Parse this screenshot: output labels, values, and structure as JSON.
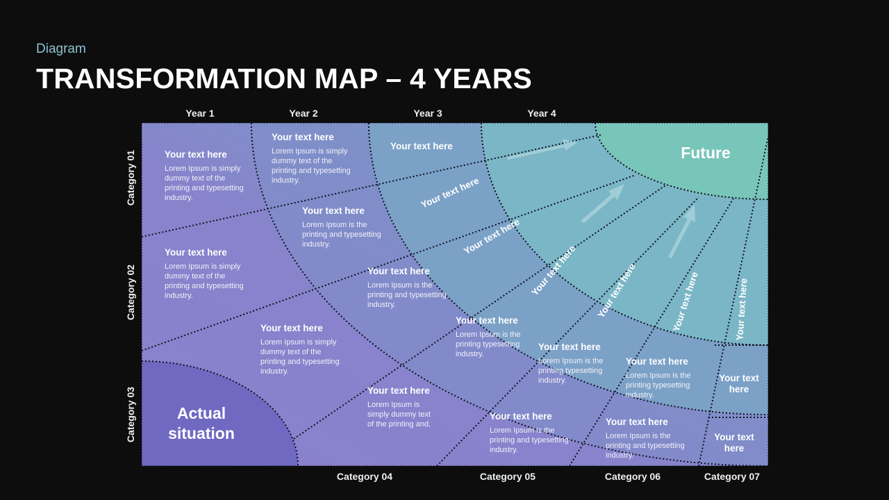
{
  "header": {
    "subtitle": "Diagram",
    "title": "TRANSFORMATION MAP – 4 YEARS"
  },
  "years": [
    "Year 1",
    "Year 2",
    "Year 3",
    "Year 4"
  ],
  "categories_left": [
    "Category 01",
    "Category 02",
    "Category 03"
  ],
  "categories_bottom": [
    "Category 04",
    "Category 05",
    "Category 06",
    "Category 07"
  ],
  "colors": {
    "background": "#0d0d0d",
    "purple": "#8a80cc",
    "purple_dark": "#7069c1",
    "blue_mid": "#7e92c8",
    "teal_light": "#7ab6c6",
    "teal_future": "#78c5b9",
    "subtitle": "#8ec3d1",
    "divider": "#0d0d1a"
  },
  "labels": {
    "actual": "Actual situation",
    "future": "Future"
  },
  "cells": [
    {
      "heading": "Your text here",
      "body": "Lorem Ipsum is simply dummy text of the printing and typesetting industry."
    },
    {
      "heading": "Your text here",
      "body": "Lorem Ipsum is simply dummy text of the printing and typesetting industry."
    },
    {
      "heading": "Your text here",
      "body": "Lorem Ipsum is the printing and typesetting industry."
    },
    {
      "heading": "Your text here",
      "body": "Lorem Ipsum is simply dummy text of the printing and typesetting industry."
    },
    {
      "heading": "Your text here",
      "body": "Lorem Ipsum is the printing and typesetting industry."
    },
    {
      "heading": "Your text here",
      "body": "Lorem Ipsum is simply dummy text of the printing and typesetting industry."
    },
    {
      "heading": "Your text here",
      "body": "Lorem Ipsum is the printing typesetting industry."
    },
    {
      "heading": "Your text here",
      "body": "Lorem Ipsum is the printing typesetting industry."
    },
    {
      "heading": "Your text here",
      "body": "Lorem Ipsum is the printing typesetting industry."
    },
    {
      "heading": "Your text here",
      "body": "Lorem Ipsum is simply dummy text of the printing and."
    },
    {
      "heading": "Your text here",
      "body": "Lorem Ipsum is the printing and typesetting industry."
    },
    {
      "heading": "Your text here",
      "body": "Lorem Ipsum is the printing and typesetting industry."
    }
  ],
  "ring_labels": [
    "Your text here",
    "Your text here",
    "Your text here",
    "Your text here",
    "Your text here",
    "Your text here",
    "Your text here"
  ],
  "corner_labels": [
    "Your text here",
    "Your text here"
  ]
}
